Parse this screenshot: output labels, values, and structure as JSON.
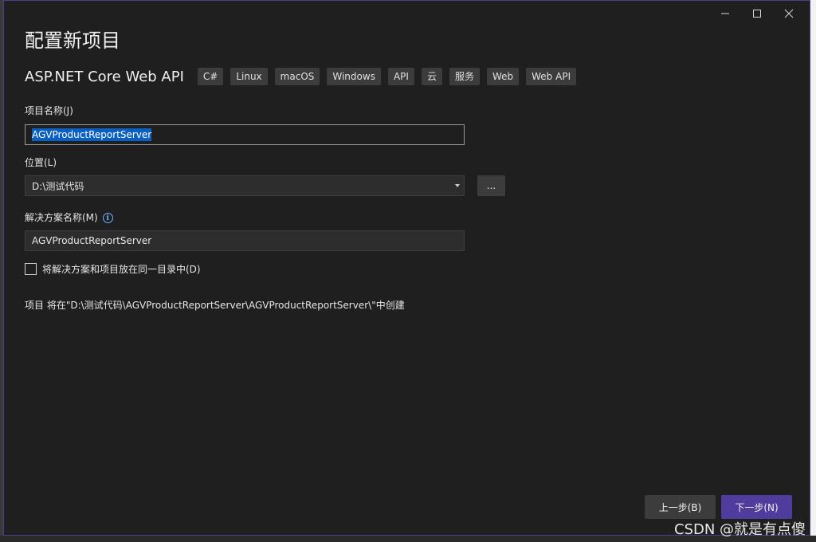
{
  "window": {
    "title": "配置新项目",
    "controls": [
      "minimize",
      "maximize",
      "close"
    ]
  },
  "template": {
    "name": "ASP.NET Core Web API",
    "tags": [
      "C#",
      "Linux",
      "macOS",
      "Windows",
      "API",
      "云",
      "服务",
      "Web",
      "Web API"
    ]
  },
  "project_name": {
    "label": "项目名称(J)",
    "value": "AGVProductReportServer"
  },
  "location": {
    "label": "位置(L)",
    "value": "D:\\测试代码",
    "browse_label": "..."
  },
  "solution_name": {
    "label": "解决方案名称(M)",
    "value": "AGVProductReportServer"
  },
  "same_directory": {
    "label": "将解决方案和项目放在同一目录中(D)",
    "checked": false
  },
  "path_note": "项目 将在\"D:\\测试代码\\AGVProductReportServer\\AGVProductReportServer\\\"中创建",
  "buttons": {
    "back": "上一步(B)",
    "next": "下一步(N)"
  },
  "watermark": "CSDN @就是有点傻",
  "colors": {
    "background": "#1f1f1f",
    "accent": "#4f3c9c",
    "selection": "#0a5fc2"
  }
}
